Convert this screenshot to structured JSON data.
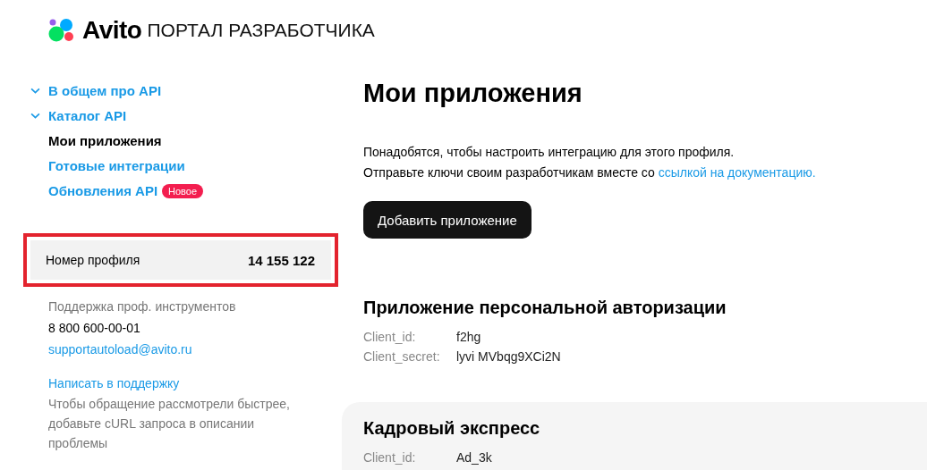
{
  "header": {
    "brand": "Avito",
    "subtitle": "ПОРТАЛ РАЗРАБОТЧИКА"
  },
  "nav": [
    {
      "label": "В общем про API",
      "kind": "group",
      "selected": false
    },
    {
      "label": "Каталог API",
      "kind": "group",
      "selected": false
    },
    {
      "label": "Мои приложения",
      "kind": "link",
      "selected": true
    },
    {
      "label": "Готовые интеграции",
      "kind": "link",
      "selected": false
    },
    {
      "label": "Обновления API",
      "kind": "link",
      "selected": false,
      "badge": "Новое"
    }
  ],
  "profile": {
    "label": "Номер профиля",
    "value": "14 155 122"
  },
  "support": {
    "title": "Поддержка проф. инструментов",
    "phone": "8 800 600-00-01",
    "email": "supportautoload@avito.ru",
    "link": "Написать в поддержку",
    "hint": "Чтобы обращение рассмотрели быстрее, добавьте cURL запроса в описании проблемы"
  },
  "page_title": "Мои приложения",
  "intro": [
    "Понадобятся, чтобы настроить интеграцию для этого профиля.",
    "Отправьте ключи своим разработчикам вместе со"
  ],
  "intro_link": "ссылкой на документацию.",
  "add_button": "Добавить приложение",
  "apps": [
    {
      "title": "Приложение персональной авторизации",
      "card": false,
      "fields": [
        {
          "label": "Client_id:",
          "value": "f2hg"
        },
        {
          "label": "Client_secret:",
          "value": "lyvi MVbqg9XCi2N"
        }
      ]
    },
    {
      "title": "Кадровый экспресс",
      "card": true,
      "fields": [
        {
          "label": "Client_id:",
          "value": "Ad_3k"
        }
      ]
    }
  ]
}
